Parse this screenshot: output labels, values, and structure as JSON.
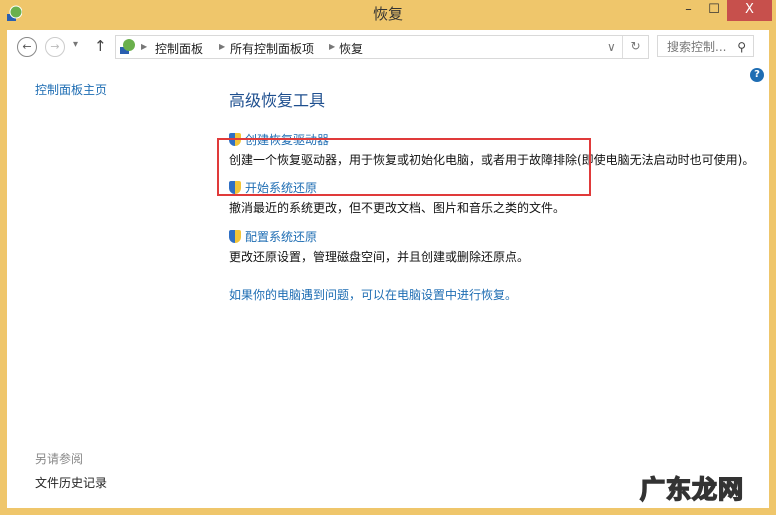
{
  "window": {
    "title": "恢复",
    "minimize": "–",
    "maximize": "☐",
    "close": "X"
  },
  "nav": {
    "back": "←",
    "forward": "→",
    "recent": "▾",
    "up": "↑",
    "breadcrumb": [
      "控制面板",
      "所有控制面板项",
      "恢复"
    ],
    "dropdown": "∨",
    "refresh": "↻",
    "search_placeholder": "搜索控制...",
    "search_icon": "⚲"
  },
  "help": "?",
  "sidebar": {
    "home": "控制面板主页",
    "see_also": "另请参阅",
    "file_history": "文件历史记录"
  },
  "main": {
    "heading": "高级恢复工具",
    "items": [
      {
        "link": "创建恢复驱动器",
        "desc": "创建一个恢复驱动器，用于恢复或初始化电脑，或者用于故障排除(即使电脑无法启动时也可使用)。"
      },
      {
        "link": "开始系统还原",
        "desc": "撤消最近的系统更改，但不更改文档、图片和音乐之类的文件。"
      },
      {
        "link": "配置系统还原",
        "desc": "更改还原设置，管理磁盘空间，并且创建或删除还原点。"
      }
    ],
    "pc_settings_link": "如果你的电脑遇到问题，可以在电脑设置中进行恢复。"
  },
  "watermark": "广东龙网"
}
